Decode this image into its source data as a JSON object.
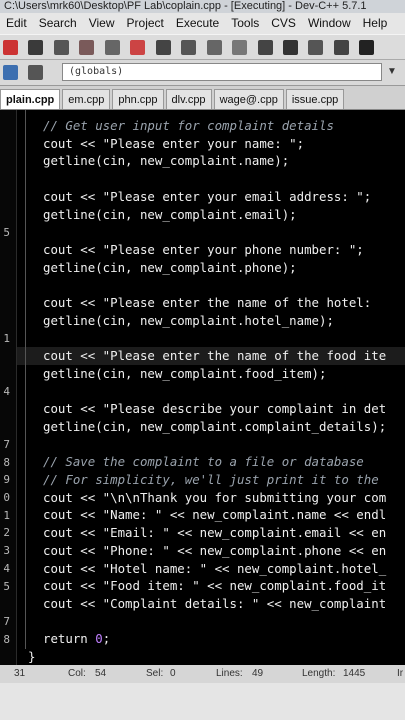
{
  "window": {
    "title": "C:\\Users\\mrk60\\Desktop\\PF Lab\\coplain.cpp - [Executing] - Dev-C++ 5.7.1"
  },
  "menu": [
    "Edit",
    "Search",
    "View",
    "Project",
    "Execute",
    "Tools",
    "CVS",
    "Window",
    "Help"
  ],
  "toolbar": {
    "scope_value": "(globals)"
  },
  "tabs": [
    "plain.cpp",
    "em.cpp",
    "phn.cpp",
    "dlv.cpp",
    "wage@.cpp",
    "issue.cpp"
  ],
  "gutter_numbers": [
    "",
    "",
    "",
    "",
    "",
    "5",
    "",
    "",
    "",
    "",
    "",
    "1",
    "",
    "",
    "4",
    "",
    "",
    "7",
    "8",
    "9",
    "0",
    "1",
    "2",
    "3",
    "4",
    "5",
    "",
    "7",
    "8"
  ],
  "code_lines": [
    {
      "t": "cm",
      "text": "// Get user input for complaint details"
    },
    {
      "t": "code",
      "text": "cout << \"Please enter your name: \";"
    },
    {
      "t": "code",
      "text": "getline(cin, new_complaint.name);"
    },
    {
      "t": "blank",
      "text": ""
    },
    {
      "t": "code",
      "text": "cout << \"Please enter your email address: \";"
    },
    {
      "t": "code",
      "text": "getline(cin, new_complaint.email);"
    },
    {
      "t": "blank",
      "text": ""
    },
    {
      "t": "code",
      "text": "cout << \"Please enter your phone number: \";"
    },
    {
      "t": "code",
      "text": "getline(cin, new_complaint.phone);"
    },
    {
      "t": "blank",
      "text": ""
    },
    {
      "t": "code",
      "text": "cout << \"Please enter the name of the hotel: "
    },
    {
      "t": "code",
      "text": "getline(cin, new_complaint.hotel_name);"
    },
    {
      "t": "blank",
      "text": ""
    },
    {
      "t": "code",
      "text": "cout << \"Please enter the name of the food ite"
    },
    {
      "t": "code",
      "text": "getline(cin, new_complaint.food_item);"
    },
    {
      "t": "blank",
      "text": ""
    },
    {
      "t": "code",
      "text": "cout << \"Please describe your complaint in det"
    },
    {
      "t": "code",
      "text": "getline(cin, new_complaint.complaint_details);"
    },
    {
      "t": "blank",
      "text": ""
    },
    {
      "t": "cm",
      "text": "// Save the complaint to a file or database"
    },
    {
      "t": "cm",
      "text": "// For simplicity, we'll just print it to the"
    },
    {
      "t": "code",
      "text": "cout << \"\\n\\nThank you for submitting your com"
    },
    {
      "t": "code",
      "text": "cout << \"Name: \" << new_complaint.name << endl"
    },
    {
      "t": "code",
      "text": "cout << \"Email: \" << new_complaint.email << en"
    },
    {
      "t": "code",
      "text": "cout << \"Phone: \" << new_complaint.phone << en"
    },
    {
      "t": "code",
      "text": "cout << \"Hotel name: \" << new_complaint.hotel_"
    },
    {
      "t": "code",
      "text": "cout << \"Food item: \" << new_complaint.food_it"
    },
    {
      "t": "code",
      "text": "cout << \"Complaint details: \" << new_complaint"
    },
    {
      "t": "blank",
      "text": ""
    },
    {
      "t": "ret",
      "text": "return 0;"
    },
    {
      "t": "brace",
      "text": "}"
    }
  ],
  "status": {
    "line": "31",
    "col_label": "Col:",
    "col": "54",
    "sel_label": "Sel:",
    "sel": "0",
    "lines_label": "Lines:",
    "lines": "49",
    "length_label": "Length:",
    "length": "1445",
    "tail": "Ir"
  }
}
